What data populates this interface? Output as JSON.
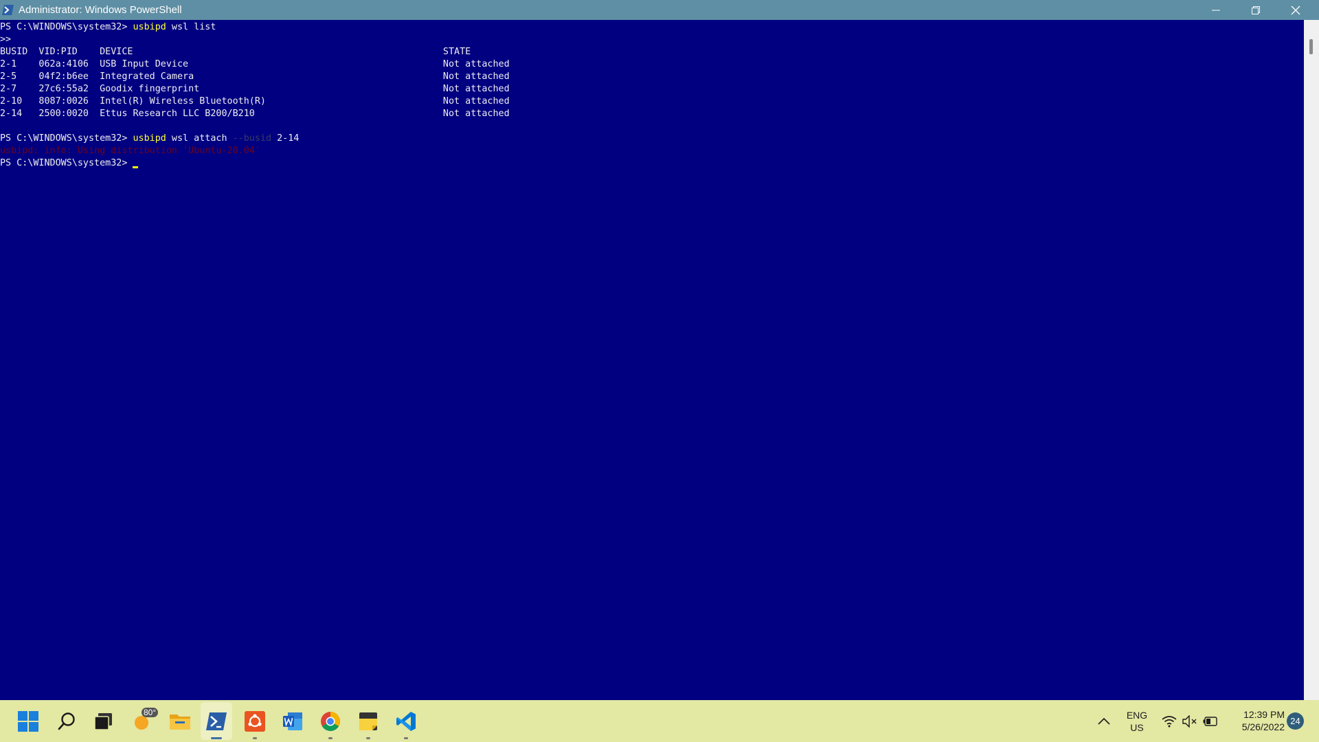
{
  "window": {
    "title": "Administrator: Windows PowerShell"
  },
  "terminal": {
    "prompt": "PS C:\\WINDOWS\\system32>",
    "line1_cmd": "usbipd",
    "line1_args": " wsl list",
    "continuation": ">>",
    "table": {
      "headers": {
        "busid": "BUSID",
        "vidpid": "VID:PID",
        "device": "DEVICE",
        "state": "STATE"
      },
      "rows": [
        {
          "busid": "2-1",
          "vidpid": "062a:4106",
          "device": "USB Input Device",
          "state": "Not attached"
        },
        {
          "busid": "2-5",
          "vidpid": "04f2:b6ee",
          "device": "Integrated Camera",
          "state": "Not attached"
        },
        {
          "busid": "2-7",
          "vidpid": "27c6:55a2",
          "device": "Goodix fingerprint",
          "state": "Not attached"
        },
        {
          "busid": "2-10",
          "vidpid": "8087:0026",
          "device": "Intel(R) Wireless Bluetooth(R)",
          "state": "Not attached"
        },
        {
          "busid": "2-14",
          "vidpid": "2500:0020",
          "device": "Ettus Research LLC B200/B210",
          "state": "Not attached"
        }
      ]
    },
    "line2_cmd": "usbipd",
    "line2_args": " wsl attach ",
    "line2_param": "--busid",
    "line2_value": " 2-14",
    "error_line": "usbipd: info: Using distribution 'Ubuntu-20.04'"
  },
  "taskbar": {
    "weather_temp": "80°",
    "apps": [
      "start-icon",
      "search-icon",
      "task-view-icon",
      "weather-icon",
      "file-explorer-icon",
      "powershell-icon",
      "ubuntu-icon",
      "word-icon",
      "chrome-icon",
      "sticky-notes-icon",
      "vscode-icon"
    ],
    "tray": {
      "lang_line1": "ENG",
      "lang_line2": "US",
      "time": "12:39 PM",
      "date": "5/26/2022",
      "notifications": "24"
    }
  },
  "colors": {
    "console_bg": "#000080",
    "title_bar": "#5f8fa4",
    "taskbar": "#e3e8a3",
    "command": "#ffff33"
  }
}
